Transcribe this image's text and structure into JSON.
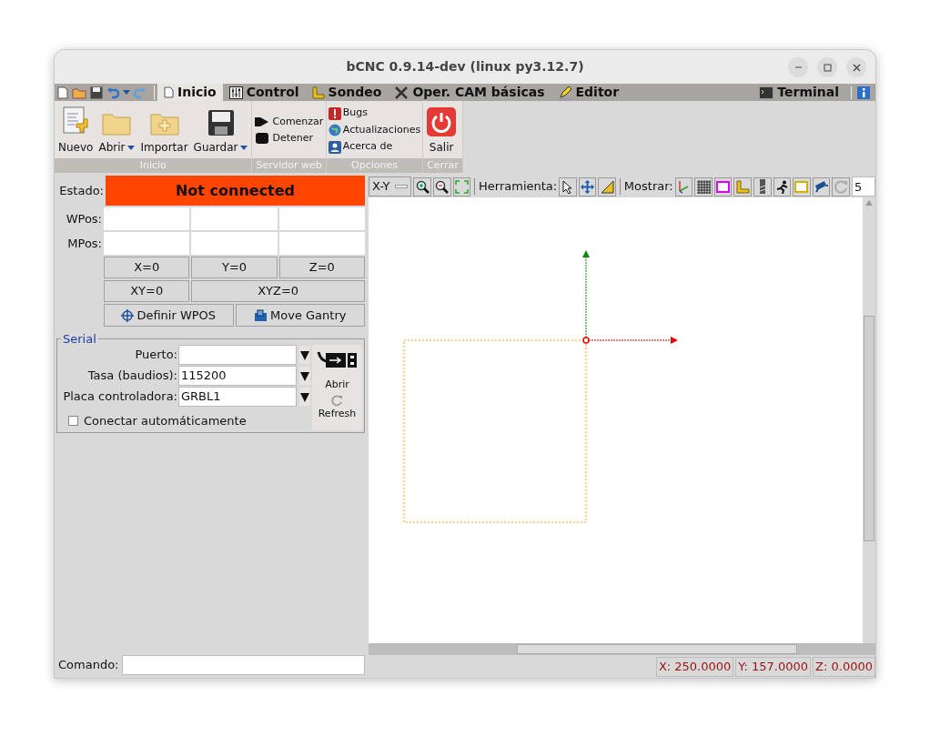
{
  "window": {
    "title": "bCNC 0.9.14-dev (linux py3.12.7)"
  },
  "tabs": [
    {
      "label": "Inicio",
      "selected": true
    },
    {
      "label": "Control",
      "selected": false
    },
    {
      "label": "Sondeo",
      "selected": false
    },
    {
      "label": "Oper. CAM básicas",
      "selected": false
    },
    {
      "label": "Editor",
      "selected": false
    }
  ],
  "terminal_tab": {
    "label": "Terminal",
    "selected": false
  },
  "ribbon": [
    {
      "label": "Inicio",
      "kind": "large",
      "buttons": [
        {
          "label": "Nuevo",
          "dropdown": false
        },
        {
          "label": "Abrir",
          "dropdown": true
        },
        {
          "label": "Importar",
          "dropdown": false
        },
        {
          "label": "Guardar",
          "dropdown": true
        }
      ]
    },
    {
      "label": "Servidor web",
      "kind": "small",
      "buttons": [
        {
          "label": "Comenzar"
        },
        {
          "label": "Detener"
        }
      ]
    },
    {
      "label": "Opciones",
      "kind": "small",
      "buttons": [
        {
          "label": "Bugs"
        },
        {
          "label": "Actualizaciones"
        },
        {
          "label": "Acerca de"
        }
      ]
    },
    {
      "label": "Cerrar",
      "kind": "large",
      "buttons": [
        {
          "label": "Salir",
          "dropdown": false
        }
      ]
    }
  ],
  "state": {
    "label": "Estado:",
    "value": "Not connected"
  },
  "positions": [
    {
      "label": "WPos:"
    },
    {
      "label": "MPos:"
    }
  ],
  "zero_buttons": [
    {
      "label": "X=0"
    },
    {
      "label": "Y=0"
    },
    {
      "label": "Z=0"
    },
    {
      "label": "XY=0"
    },
    {
      "label": "XYZ=0"
    }
  ],
  "action_buttons": [
    {
      "label": "Definir WPOS"
    },
    {
      "label": "Move Gantry"
    }
  ],
  "serial": {
    "title": "Serial",
    "fields": [
      {
        "label": "Puerto:"
      },
      {
        "label": "Tasa (baudios):",
        "value": "115200"
      },
      {
        "label": "Placa controladora:",
        "value": "GRBL1"
      }
    ],
    "autoconnect": {
      "label": "Conectar automáticamente",
      "checked": false
    },
    "open": "Abrir",
    "refresh": "Refresh"
  },
  "canvas_toolbar": {
    "view": "X-Y",
    "tool_label": "Herramienta:",
    "show_label": "Mostrar:",
    "number": "5"
  },
  "command": {
    "label": "Comando:"
  },
  "status_bar": [
    "X: 250.0000",
    "Y: 157.0000",
    "Z: 0.0000"
  ]
}
